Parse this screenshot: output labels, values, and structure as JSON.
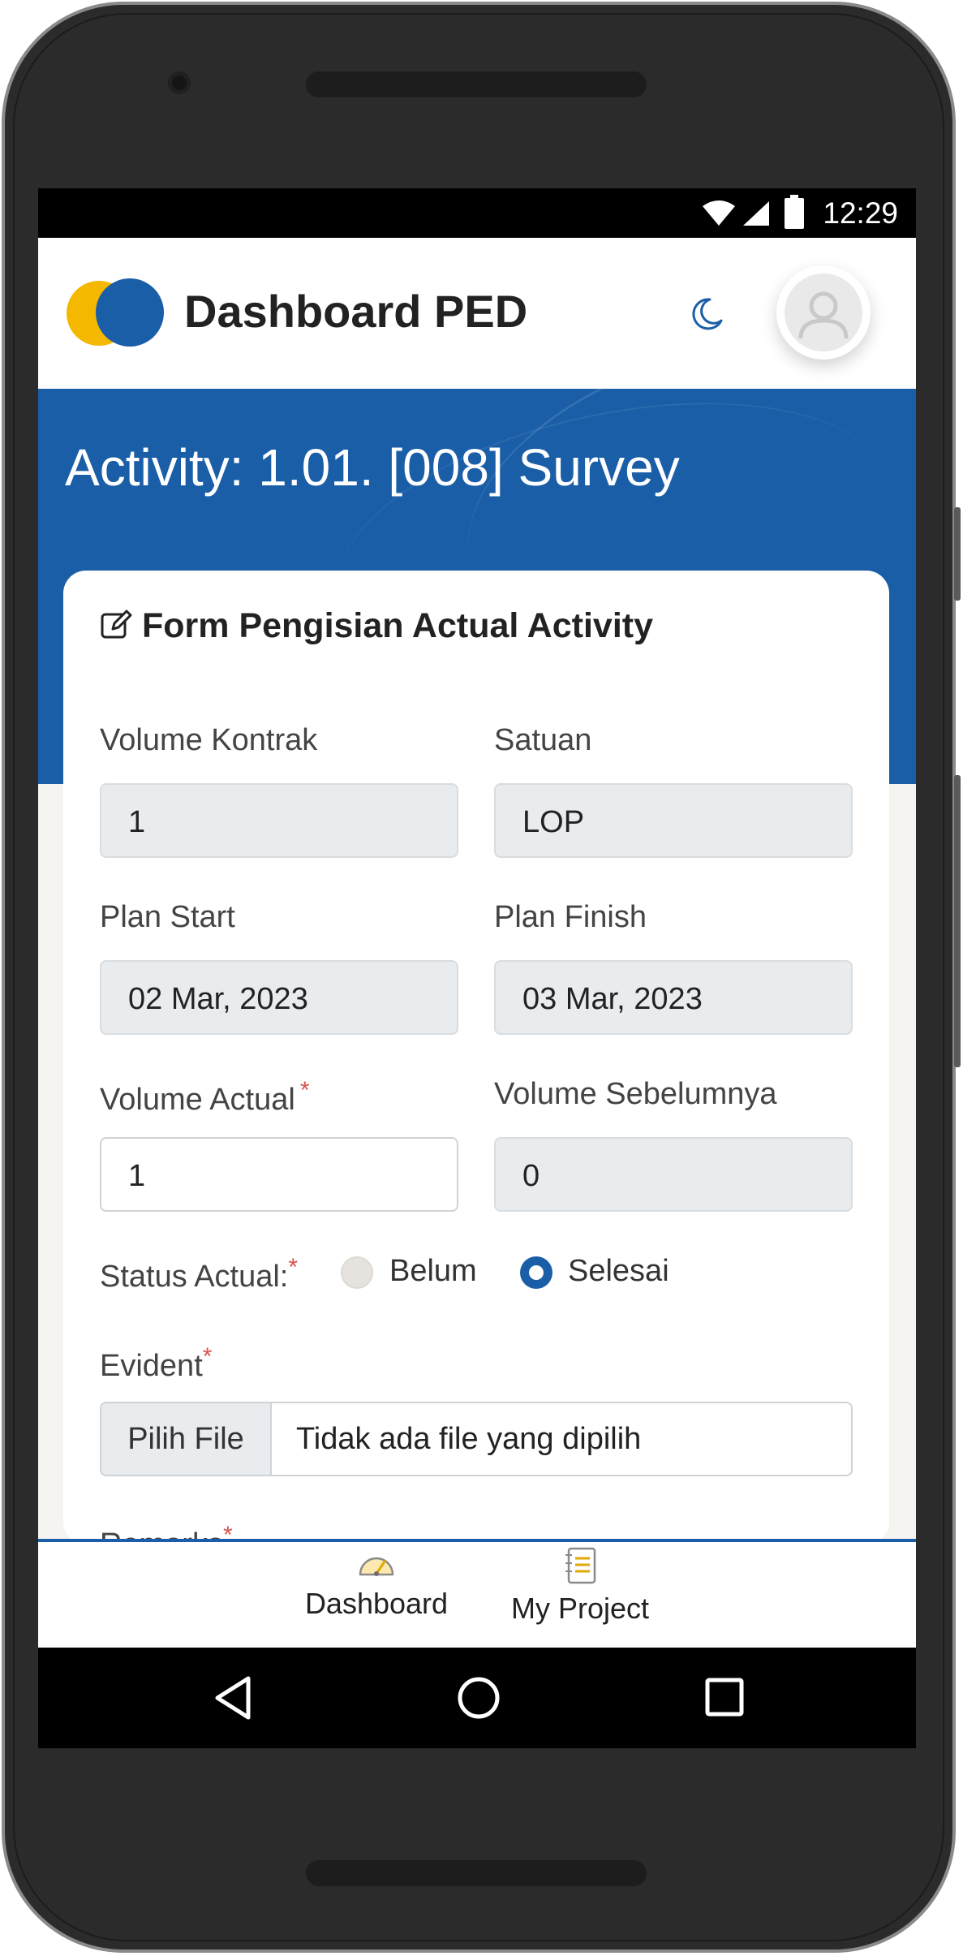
{
  "status_bar": {
    "time": "12:29"
  },
  "header": {
    "app_title": "Dashboard PED"
  },
  "banner": {
    "title": "Activity: 1.01. [008] Survey"
  },
  "form": {
    "title": "Form Pengisian Actual Activity",
    "volume_kontrak": {
      "label": "Volume Kontrak",
      "value": "1"
    },
    "satuan": {
      "label": "Satuan",
      "value": "LOP"
    },
    "plan_start": {
      "label": "Plan Start",
      "value": "02 Mar, 2023"
    },
    "plan_finish": {
      "label": "Plan Finish",
      "value": "03 Mar, 2023"
    },
    "volume_actual": {
      "label": "Volume Actual",
      "value": "1",
      "required_mark": "*"
    },
    "volume_sebelumnya": {
      "label": "Volume Sebelumnya",
      "value": "0"
    },
    "status_actual": {
      "label": "Status Actual:",
      "required_mark": "*",
      "options": [
        "Belum",
        "Selesai"
      ],
      "selected": "Selesai"
    },
    "evident": {
      "label": "Evident",
      "required_mark": "*",
      "button_label": "Pilih File",
      "file_text": "Tidak ada file yang dipilih"
    },
    "remarks": {
      "label": "Remarks",
      "required_mark": "*"
    }
  },
  "bottom_nav": {
    "items": [
      {
        "label": "Dashboard",
        "icon": "speedometer-icon"
      },
      {
        "label": "My Project",
        "icon": "notebook-icon"
      }
    ]
  },
  "colors": {
    "primary": "#1a5ea7",
    "accent": "#f5b800",
    "required": "#d9534f"
  }
}
